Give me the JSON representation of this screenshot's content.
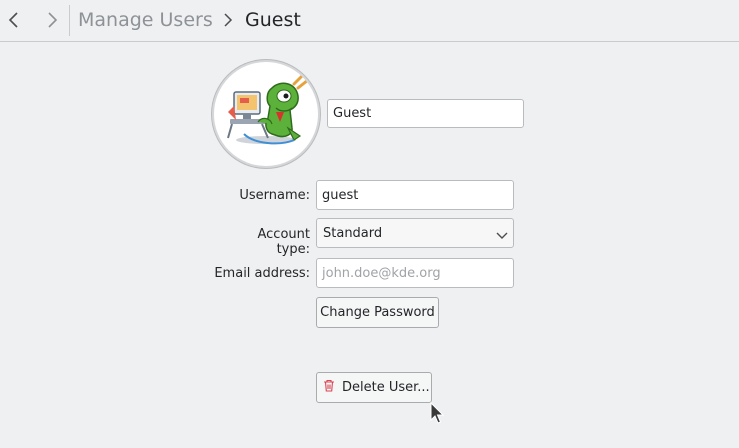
{
  "breadcrumb": {
    "parent": "Manage Users",
    "current": "Guest"
  },
  "icons": {
    "back": "chevron-left-icon",
    "forward": "chevron-right-icon",
    "breadcrumb_separator": "chevron-right-icon",
    "dropdown": "chevron-down-icon",
    "delete": "trash-icon",
    "avatar": "konqi-dragon-at-computer-avatar"
  },
  "user": {
    "display_name": "Guest",
    "username_label": "Username:",
    "username": "guest",
    "account_type_label": "Account type:",
    "account_type": "Standard",
    "email_label": "Email address:",
    "email_placeholder": "john.doe@kde.org",
    "email_value": ""
  },
  "buttons": {
    "change_password": "Change Password",
    "delete_user": "Delete User..."
  },
  "colors": {
    "background": "#eff0f1",
    "text": "#232629",
    "muted": "#8e9297",
    "delete_icon": "#da4453"
  }
}
